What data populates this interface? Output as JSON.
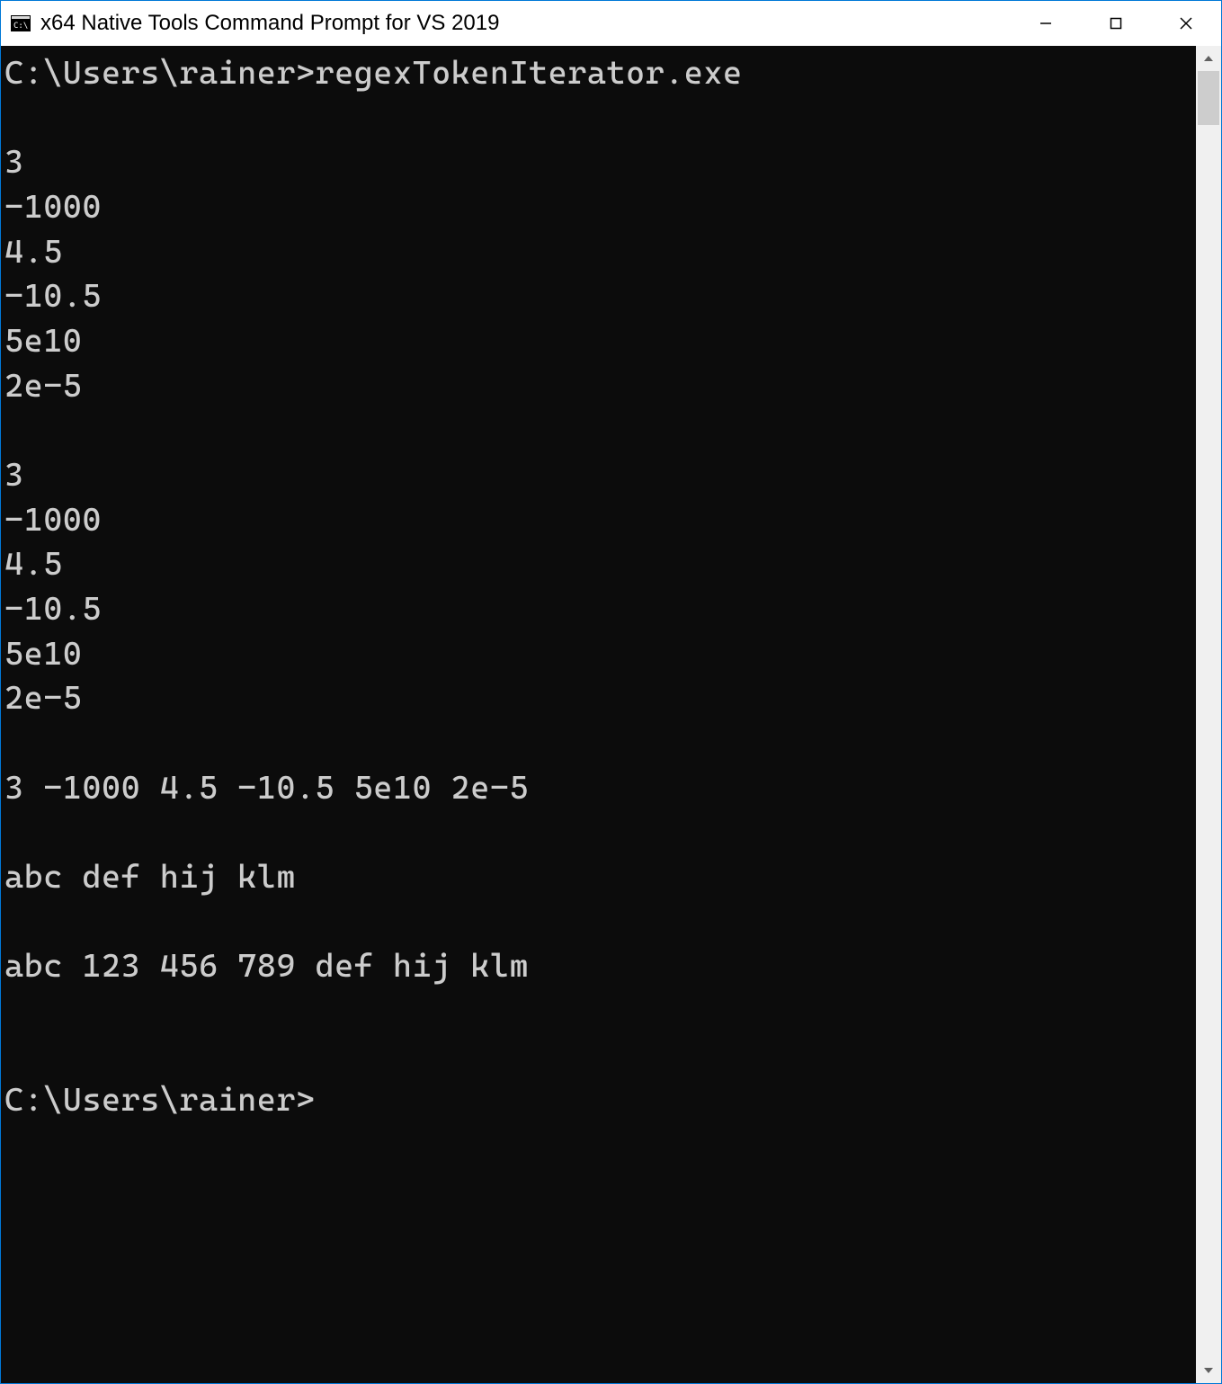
{
  "window": {
    "title": "x64 Native Tools Command Prompt for VS 2019"
  },
  "terminal": {
    "lines": [
      "C:\\Users\\rainer>regexTokenIterator.exe",
      "",
      "3",
      "-1000",
      "4.5",
      "-10.5",
      "5e10",
      "2e-5",
      "",
      "3",
      "-1000",
      "4.5",
      "-10.5",
      "5e10",
      "2e-5",
      "",
      "3 -1000 4.5 -10.5 5e10 2e-5",
      "",
      "abc def hij klm",
      "",
      "abc 123 456 789 def hij klm",
      "",
      "",
      "C:\\Users\\rainer>"
    ]
  }
}
